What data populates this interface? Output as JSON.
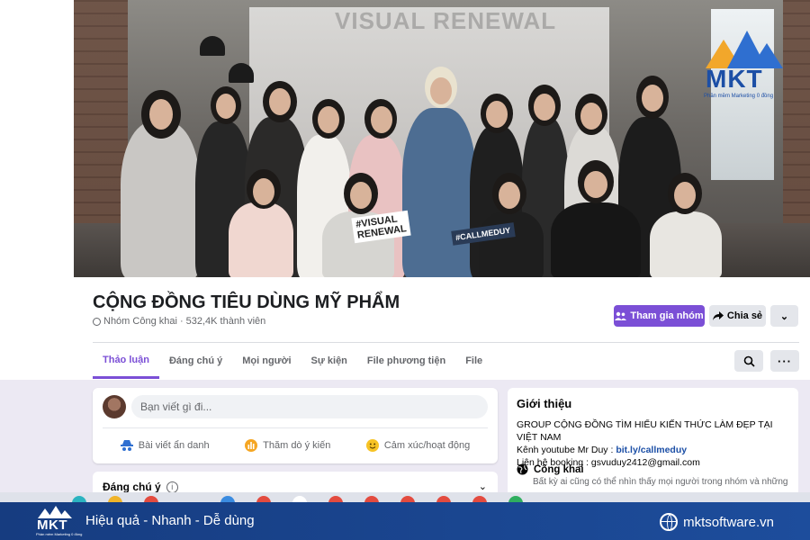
{
  "cover": {
    "banner_text": "VISUAL RENEWAL",
    "sign_left": "#VISUAL\nRENEWAL",
    "sign_right": "#CALLMEDUY",
    "logo": {
      "text": "MKT",
      "subtitle": "Phần mềm Marketing 0 đồng"
    }
  },
  "group": {
    "title": "CỘNG ĐỒNG TIÊU DÙNG MỸ PHẨM",
    "privacy": "Nhóm Công khai",
    "separator": " · ",
    "members": "532,4K thành viên"
  },
  "actions": {
    "join_label": "Tham gia nhóm",
    "share_label": "Chia sẻ",
    "join_color": "#7b4fd6"
  },
  "tabs": [
    {
      "label": "Thảo luận",
      "active": true
    },
    {
      "label": "Đáng chú ý",
      "active": false
    },
    {
      "label": "Mọi người",
      "active": false
    },
    {
      "label": "Sự kiện",
      "active": false
    },
    {
      "label": "File phương tiện",
      "active": false
    },
    {
      "label": "File",
      "active": false
    }
  ],
  "composer": {
    "placeholder": "Bạn viết gì đi...",
    "anonymous_label": "Bài viết ẩn danh",
    "poll_label": "Thăm dò ý kiến",
    "feeling_label": "Cảm xúc/hoạt động"
  },
  "pinned": {
    "label": "Đáng chú ý"
  },
  "about": {
    "title": "Giới thiệu",
    "line1": "GROUP CỘNG ĐỒNG TÌM HIỂU KIẾN THỨC LÀM ĐẸP TẠI VIỆT NAM",
    "line2_prefix": "Kênh youtube Mr Duy : ",
    "line2_link": "bit.ly/callmeduy",
    "line3": "Liên hệ booking : gsvuduy2412@gmail.com",
    "public_title": "Công khai",
    "public_desc": "Bất kỳ ai cũng có thể nhìn thấy mọi người trong nhóm và những"
  },
  "brandbar": {
    "logo_text": "MKT",
    "logo_sub": "Phần mềm Marketing 0 đồng",
    "slogan": "Hiệu quả - Nhanh - Dễ dùng",
    "website": "mktsoftware.vn",
    "bg_color": "#1d4d9c"
  }
}
